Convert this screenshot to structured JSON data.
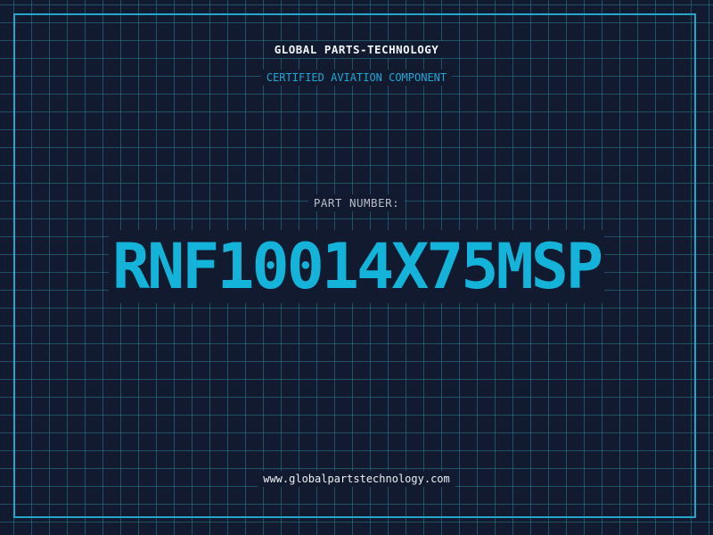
{
  "label": {
    "company": "GLOBAL PARTS-TECHNOLOGY",
    "subtitle": "CERTIFIED AVIATION COMPONENT",
    "part_label": "PART NUMBER:",
    "part_number": "RNF10014X75MSP",
    "website": "www.globalpartstechnology.com"
  },
  "colors": {
    "background": "#111a2e",
    "grid": "#268096",
    "frame": "#25a5c9",
    "accent": "#14b3d9",
    "text": "#f2f4f8",
    "muted_text": "#b8bfcb"
  }
}
